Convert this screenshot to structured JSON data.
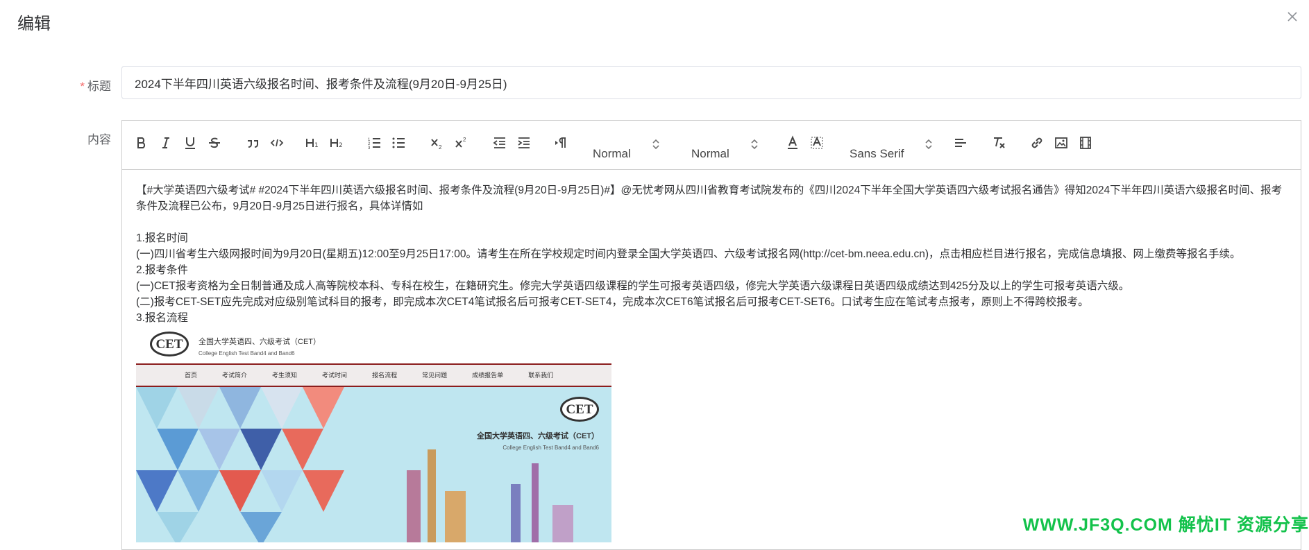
{
  "dialog": {
    "title": "编辑"
  },
  "form": {
    "title_label": "标题",
    "required_mark": "*",
    "title_value": "2024下半年四川英语六级报名时间、报考条件及流程(9月20日-9月25日)",
    "content_label": "内容"
  },
  "toolbar": {
    "header_picker": "Normal",
    "size_picker": "Normal",
    "font_picker": "Sans Serif"
  },
  "content": {
    "p1": "【#大学英语四六级考试# #2024下半年四川英语六级报名时间、报考条件及流程(9月20日-9月25日)#】@无忧考网从四川省教育考试院发布的《四川2024下半年全国大学英语四六级考试报名通告》得知2024下半年四川英语六级报名时间、报考条件及流程已公布，9月20日-9月25日进行报名，具体详情如",
    "h1": "1.报名时间",
    "p2": "(一)四川省考生六级网报时间为9月20日(星期五)12:00至9月25日17:00。请考生在所在学校规定时间内登录全国大学英语四、六级考试报名网(http://cet-bm.neea.edu.cn)，点击相应栏目进行报名，完成信息填报、网上缴费等报名手续。",
    "h2": "2.报考条件",
    "p3": "(一)CET报考资格为全日制普通及成人高等院校本科、专科在校生，在籍研究生。修完大学英语四级课程的学生可报考英语四级，修完大学英语六级课程日英语四级成绩达到425分及以上的学生可报考英语六级。",
    "p4": "(二)报考CET-SET应先完成对应级别笔试科目的报考，即完成本次CET4笔试报名后可报考CET-SET4，完成本次CET6笔试报名后可报考CET-SET6。口试考生应在笔试考点报考，原则上不得跨校报考。",
    "h3": "3.报名流程"
  },
  "cet_image": {
    "logo": "CET",
    "title_cn": "全国大学英语四、六级考试（CET）",
    "title_en": "College English Test Band4 and Band6",
    "nav": [
      "首页",
      "考试简介",
      "考生须知",
      "考试时间",
      "报名流程",
      "常见问题",
      "成绩报告单",
      "联系我们"
    ],
    "banner_cn": "全国大学英语四、六级考试（CET）",
    "banner_en": "College English Test Band4 and Band6"
  },
  "watermark": "WWW.JF3Q.COM 解忧IT 资源分享",
  "colors": {
    "required": "#f56c6c",
    "border": "#dcdfe6",
    "watermark": "#13c24b"
  }
}
